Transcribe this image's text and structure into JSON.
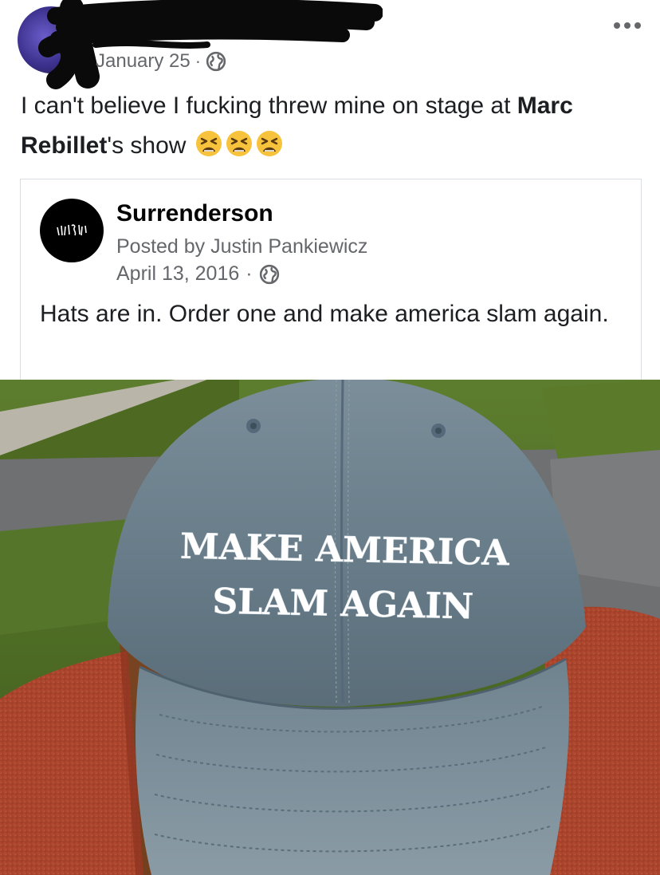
{
  "outer_post": {
    "date": "January 25",
    "separator": "·",
    "text_part1": "I can't believe I fucking threw mine on stage at ",
    "text_bold": "Marc Rebillet",
    "text_part2": "'s show"
  },
  "shared_post": {
    "page_name": "Surrenderson",
    "posted_by": "Posted by Justin Pankiewicz",
    "date": "April 13, 2016",
    "separator": "·",
    "text": "Hats are in. Order one and make america slam again."
  },
  "photo": {
    "hat_line1": "MAKE AMERICA",
    "hat_line2": "SLAM AGAIN"
  },
  "icons": {
    "globe": "globe-icon",
    "more": "more-icon",
    "emoji": "tired-face-emoji-icon"
  },
  "colors": {
    "secondary_text": "#65676b",
    "primary_text": "#1c1e21",
    "hat": "#6b7f8c",
    "sweater": "#b0482f"
  }
}
